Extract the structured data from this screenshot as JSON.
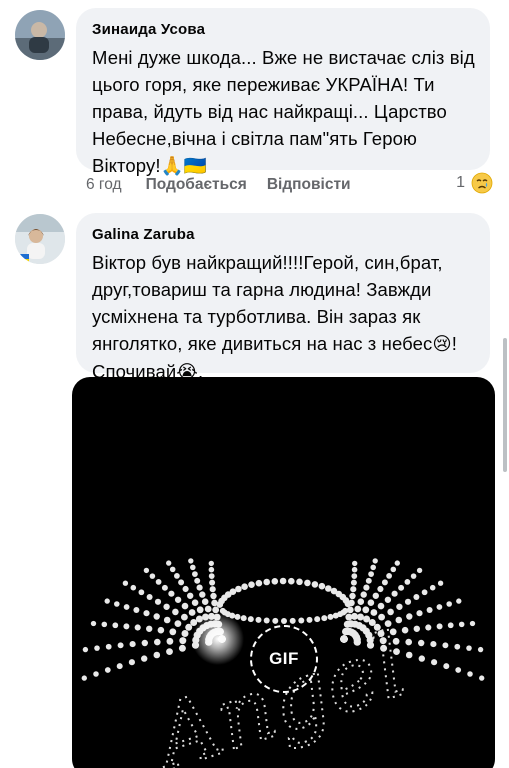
{
  "comments": [
    {
      "author": "Зинаида Усова",
      "lines": [
        "Мені дуже шкода... Вже не вистачає сліз від",
        "цього горя, яке переживає УКРАЇНА! Ти",
        "права, йдуть від нас найкращі... Царство",
        "Небесне,вічна і світла пам\"ять Герою",
        "Віктору!"
      ],
      "emoji_after": "🙏🇺🇦",
      "time": "6 год",
      "like_label": "Подобається",
      "reply_label": "Відповісти",
      "reaction_count": "1",
      "reaction_icon": "crying-face-icon"
    },
    {
      "author": "Galina  Zaruba",
      "lines": [
        "Віктор  був найкращий!!!!Герой, син,брат,",
        "друг,товариш та гарна людина! Завжди",
        "усміхнена та турботлива. Він зараз як",
        "янголятко, яке дивиться на нас з небес",
        "Спочивай"
      ],
      "emoji_line4": "😢",
      "line4_end": "!",
      "emoji_line5": "😭",
      "line5_end": ".",
      "attachment": {
        "type": "gif",
        "badge": "GIF",
        "image_text": "Angel"
      }
    }
  ]
}
